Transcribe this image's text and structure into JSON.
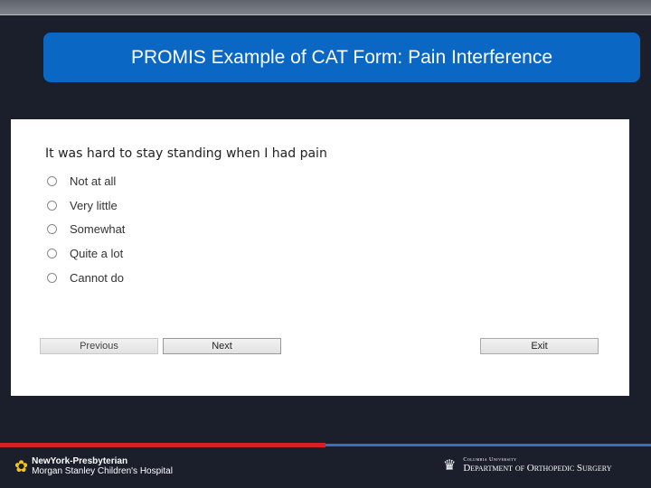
{
  "header": {
    "title": "PROMIS Example of CAT Form: Pain Interference"
  },
  "form": {
    "question": "It was hard to stay standing when I had pain",
    "options": [
      {
        "label": "Not at all",
        "selected": false
      },
      {
        "label": "Very little",
        "selected": false
      },
      {
        "label": "Somewhat",
        "selected": false
      },
      {
        "label": "Quite a lot",
        "selected": false
      },
      {
        "label": "Cannot do",
        "selected": false
      }
    ],
    "buttons": {
      "previous": "Previous",
      "next": "Next",
      "exit": "Exit"
    }
  },
  "footer": {
    "left_logo": {
      "line1": "NewYork-Presbyterian",
      "line2": "Morgan Stanley Children's Hospital",
      "icon": "daffodil-icon"
    },
    "right_logo": {
      "line1": "Columbia University",
      "line2": "Department of Orthopedic Surgery",
      "icon": "crown-icon"
    },
    "colors": {
      "red": "#d42026",
      "blue": "#3b6eb5"
    }
  },
  "colors": {
    "title_bg": "#0a67c4",
    "background": "#1a1f2b"
  }
}
